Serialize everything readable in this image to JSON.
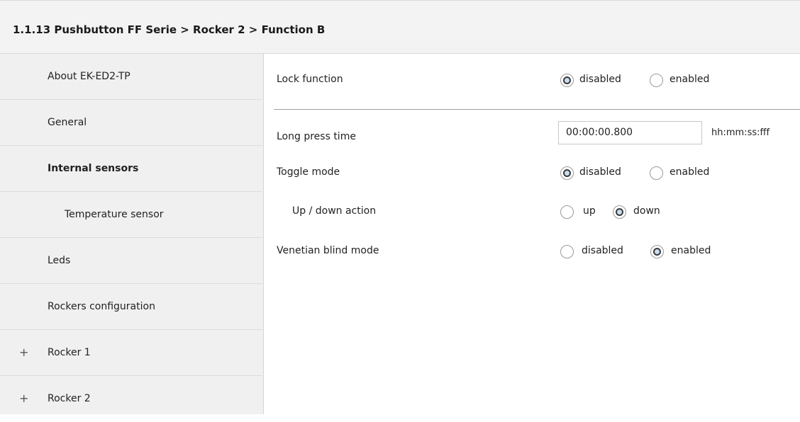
{
  "header": {
    "title": "1.1.13 Pushbutton FF Serie > Rocker 2 > Function B"
  },
  "sidebar": {
    "items": [
      {
        "label": "About EK-ED2-TP"
      },
      {
        "label": "General"
      },
      {
        "label": "Internal sensors"
      },
      {
        "label": "Temperature sensor"
      },
      {
        "label": "Leds"
      },
      {
        "label": "Rockers configuration"
      },
      {
        "label": "Rocker 1",
        "expander": "+"
      },
      {
        "label": "Rocker 2",
        "expander": "+"
      }
    ]
  },
  "params": {
    "lock_function": {
      "label": "Lock function",
      "options": [
        "disabled",
        "enabled"
      ],
      "selected": "disabled"
    },
    "long_press_time": {
      "label": "Long press time",
      "value": "00:00:00.800",
      "unit": "hh:mm:ss:fff"
    },
    "toggle_mode": {
      "label": "Toggle mode",
      "options": [
        "disabled",
        "enabled"
      ],
      "selected": "disabled"
    },
    "up_down_action": {
      "label": "Up / down action",
      "options": [
        "up",
        "down"
      ],
      "selected": "down"
    },
    "venetian_blind_mode": {
      "label": "Venetian blind mode",
      "options": [
        "disabled",
        "enabled"
      ],
      "selected": "enabled"
    }
  }
}
